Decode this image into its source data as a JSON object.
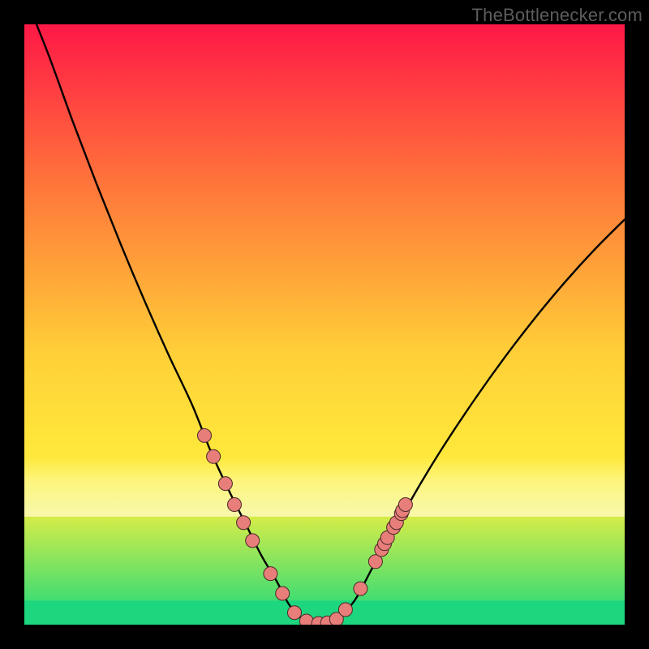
{
  "watermark": "TheBottlenecker.com",
  "colors": {
    "background": "#000000",
    "watermark_color": "#5d5d5d",
    "curve_stroke": "#000000",
    "marker_fill": "#e87e7a",
    "marker_stroke": "#4a2a28",
    "band_yellow": "#fbf9b1",
    "band_green": "#1dd77f",
    "gradient_top": "#ff1846",
    "gradient_mid1": "#ff7a3a",
    "gradient_mid2": "#ffd038",
    "gradient_mid3": "#fff13c",
    "gradient_bottom": "#18d87e"
  },
  "chart_data": {
    "type": "line",
    "title": "",
    "xlabel": "",
    "ylabel": "",
    "xlim": [
      0,
      100
    ],
    "ylim": [
      0,
      100
    ],
    "grid": false,
    "series": [
      {
        "name": "v-curve",
        "x": [
          0,
          4,
          8,
          12,
          16,
          20,
          24,
          28,
          31,
          34,
          37,
          39.5,
          42,
          44,
          46,
          49,
          52,
          55,
          58,
          62,
          66,
          70,
          75,
          80,
          85,
          90,
          95,
          100
        ],
        "y": [
          105,
          95,
          84,
          73.5,
          63.5,
          54,
          45,
          36.5,
          29,
          22.5,
          16.5,
          11.5,
          7.3,
          3.5,
          1.2,
          0.2,
          1.0,
          4.0,
          9.5,
          16.5,
          23.5,
          30.0,
          37.5,
          44.5,
          51.0,
          57.0,
          62.5,
          67.5
        ]
      }
    ],
    "markers": [
      {
        "x": 30.0,
        "y": 31.5
      },
      {
        "x": 31.5,
        "y": 28.0
      },
      {
        "x": 33.5,
        "y": 23.5
      },
      {
        "x": 35.0,
        "y": 20.0
      },
      {
        "x": 36.5,
        "y": 17.0
      },
      {
        "x": 38.0,
        "y": 14.0
      },
      {
        "x": 41.0,
        "y": 8.5
      },
      {
        "x": 43.0,
        "y": 5.2
      },
      {
        "x": 45.0,
        "y": 2.0
      },
      {
        "x": 47.0,
        "y": 0.6
      },
      {
        "x": 49.0,
        "y": 0.2
      },
      {
        "x": 50.5,
        "y": 0.3
      },
      {
        "x": 52.0,
        "y": 0.9
      },
      {
        "x": 53.5,
        "y": 2.5
      },
      {
        "x": 56.0,
        "y": 6.0
      },
      {
        "x": 58.5,
        "y": 10.5
      },
      {
        "x": 59.5,
        "y": 12.5
      },
      {
        "x": 60.0,
        "y": 13.5
      },
      {
        "x": 60.5,
        "y": 14.5
      },
      {
        "x": 61.5,
        "y": 16.2
      },
      {
        "x": 62.0,
        "y": 17.0
      },
      {
        "x": 62.8,
        "y": 18.5
      },
      {
        "x": 63.0,
        "y": 19.0
      },
      {
        "x": 63.5,
        "y": 20.0
      }
    ],
    "bands": [
      {
        "name": "yellow-band",
        "y_from": 18,
        "y_to": 28,
        "gradient": [
          "#fbf9b1",
          "#fbf9b1",
          "rgba(251,249,177,0)"
        ]
      },
      {
        "name": "green-band",
        "y_from": 0,
        "y_to": 4,
        "gradient": [
          "#1dd77f",
          "#1dd77f"
        ]
      }
    ]
  }
}
